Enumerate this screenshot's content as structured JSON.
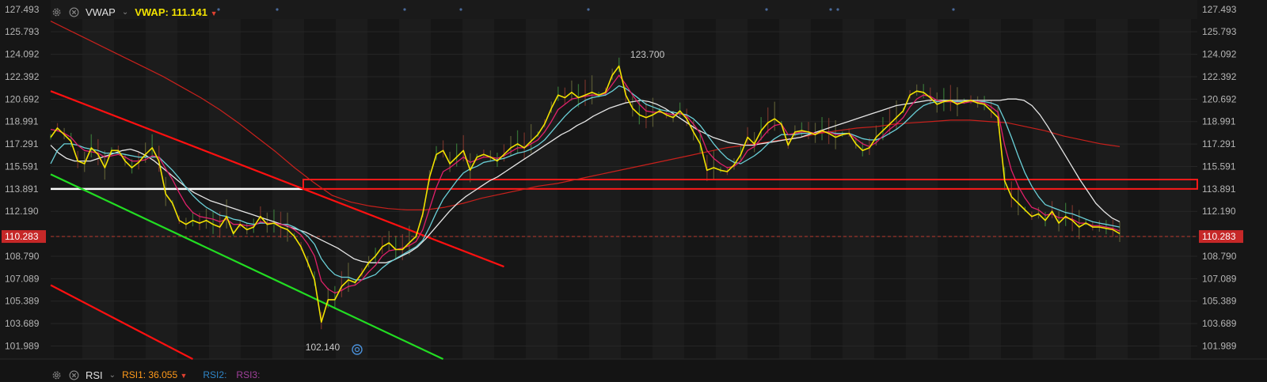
{
  "colors": {
    "background": "#161616",
    "grid": "#262626",
    "price_line": "#f2e200",
    "fast_ma": "#e0206a",
    "mid_ma": "#6ad0d8",
    "slow_ma": "#e6e6e6",
    "long_ma": "#c8211c",
    "level_red": "#ff1a1a",
    "level_white": "#ffffff",
    "trend_red": "#ff1010",
    "trend_green": "#22dd22",
    "current_price": "#e04030",
    "axis_text": "#b5b5b5",
    "rsi1": "#ff9a1a",
    "rsi2": "#2f86c8",
    "rsi3": "#a0409a"
  },
  "vwap_header": {
    "name": "VWAP",
    "value_label": "VWAP:",
    "value": "111.141",
    "settings_icon": "gear-icon",
    "close_icon": "close-icon",
    "chevron_icon": "chevron-down-icon"
  },
  "rsi_header": {
    "name": "RSI",
    "rsi1_label": "RSI1:",
    "rsi1_value": "36.055",
    "rsi2_label": "RSI2:",
    "rsi3_label": "RSI3:",
    "settings_icon": "gear-icon",
    "close_icon": "close-icon",
    "chevron_icon": "chevron-down-icon"
  },
  "current_price": "110.283",
  "chart_data": {
    "type": "line",
    "ylim": [
      101.0,
      128.2
    ],
    "y_ticks": [
      "127.493",
      "125.793",
      "124.092",
      "122.392",
      "120.692",
      "118.991",
      "117.291",
      "115.591",
      "113.891",
      "112.190",
      "110.283",
      "108.790",
      "107.089",
      "105.389",
      "103.689",
      "101.989"
    ],
    "annotations": [
      {
        "text": "123.700",
        "bar": 88,
        "value": 123.7
      },
      {
        "text": "102.140",
        "bar": 40,
        "value": 102.14
      }
    ],
    "series": [
      {
        "values": [
          117.8,
          118.5,
          118.0,
          117.5,
          116.0,
          115.8,
          117.0,
          116.5,
          115.5,
          116.8,
          116.8,
          116.0,
          115.5,
          115.9,
          116.5,
          117.0,
          116.0,
          113.5,
          112.8,
          111.5,
          111.2,
          111.5,
          111.3,
          111.5,
          111.2,
          111.0,
          111.8,
          110.5,
          111.2,
          110.8,
          111.0,
          111.8,
          111.2,
          111.3,
          111.0,
          110.8,
          110.3,
          109.5,
          108.3,
          107.0,
          103.8,
          105.5,
          105.5,
          106.5,
          107.0,
          106.8,
          107.5,
          108.3,
          108.8,
          109.5,
          109.8,
          109.3,
          109.3,
          109.8,
          110.3,
          112.0,
          114.8,
          116.5,
          116.8,
          115.8,
          116.3,
          116.8,
          115.3,
          116.3,
          116.5,
          116.3,
          116.0,
          116.5,
          117.0,
          117.3,
          117.0,
          117.5,
          118.0,
          118.8,
          120.0,
          121.0,
          120.8,
          121.2,
          120.8,
          121.0,
          121.2,
          121.0,
          121.2,
          122.5,
          123.2,
          121.0,
          120.0,
          119.5,
          119.3,
          119.5,
          119.8,
          119.5,
          119.3,
          119.8,
          119.2,
          118.2,
          117.3,
          115.3,
          115.5,
          115.3,
          115.2,
          115.7,
          116.5,
          117.8,
          117.3,
          118.3,
          118.9,
          119.2,
          118.8,
          117.2,
          118.2,
          118.3,
          118.2,
          118.0,
          118.3,
          118.1,
          117.8,
          118.0,
          118.1,
          117.3,
          116.8,
          117.0,
          117.8,
          118.3,
          118.8,
          119.3,
          119.8,
          121.0,
          121.3,
          121.2,
          120.8,
          120.3,
          120.5,
          120.6,
          120.3,
          120.5,
          120.6,
          120.4,
          120.3,
          119.8,
          119.3,
          114.5,
          113.3,
          112.8,
          112.3,
          111.8,
          112.0,
          111.5,
          112.2,
          111.3,
          111.8,
          111.5,
          111.0,
          111.3,
          111.0,
          111.0,
          110.9,
          110.8,
          110.5
        ]
      },
      {
        "values": [
          118.4,
          118.3,
          118.1,
          117.8,
          117.2,
          116.8,
          116.7,
          116.6,
          116.3,
          116.4,
          116.5,
          116.3,
          116.0,
          116.0,
          116.1,
          116.4,
          116.3,
          115.4,
          114.6,
          113.6,
          112.7,
          112.1,
          111.8,
          111.7,
          111.6,
          111.4,
          111.6,
          111.2,
          111.2,
          111.1,
          111.1,
          111.4,
          111.3,
          111.3,
          111.2,
          111.1,
          110.8,
          110.4,
          109.7,
          108.8,
          106.9,
          106.3,
          106.0,
          106.2,
          106.5,
          106.6,
          107.0,
          107.6,
          108.1,
          108.8,
          109.2,
          109.3,
          109.4,
          109.6,
          109.9,
          110.8,
          112.4,
          114.0,
          115.2,
          115.5,
          115.9,
          116.3,
          115.9,
          116.1,
          116.3,
          116.3,
          116.2,
          116.4,
          116.7,
          117.0,
          117.0,
          117.3,
          117.6,
          118.2,
          119.0,
          119.9,
          120.3,
          120.7,
          120.8,
          120.9,
          121.0,
          121.0,
          121.1,
          121.8,
          122.5,
          121.8,
          121.0,
          120.3,
          119.8,
          119.7,
          119.7,
          119.6,
          119.5,
          119.6,
          119.4,
          118.8,
          118.1,
          116.8,
          116.2,
          115.8,
          115.5,
          115.6,
          116.0,
          116.8,
          117.1,
          117.7,
          118.3,
          118.7,
          118.8,
          118.0,
          118.1,
          118.2,
          118.2,
          118.1,
          118.2,
          118.2,
          118.0,
          118.0,
          118.1,
          117.7,
          117.3,
          117.1,
          117.4,
          117.9,
          118.4,
          118.8,
          119.3,
          120.1,
          120.7,
          121.0,
          120.9,
          120.6,
          120.5,
          120.5,
          120.4,
          120.4,
          120.5,
          120.5,
          120.4,
          120.1,
          119.7,
          117.2,
          115.3,
          114.1,
          113.2,
          112.5,
          112.3,
          111.9,
          112.0,
          111.7,
          111.7,
          111.6,
          111.3,
          111.3,
          111.1,
          111.1,
          111.0,
          110.9,
          110.7
        ]
      },
      {
        "values": [
          115.8,
          116.8,
          117.3,
          117.3,
          117.2,
          117.0,
          116.9,
          116.8,
          116.6,
          116.6,
          116.6,
          116.5,
          116.4,
          116.3,
          116.3,
          116.3,
          116.3,
          115.8,
          115.3,
          114.7,
          114.0,
          113.4,
          112.9,
          112.5,
          112.2,
          111.9,
          111.8,
          111.6,
          111.5,
          111.3,
          111.2,
          111.3,
          111.3,
          111.3,
          111.2,
          111.2,
          111.0,
          110.7,
          110.3,
          109.7,
          108.6,
          107.9,
          107.4,
          107.2,
          107.2,
          107.0,
          107.0,
          107.2,
          107.4,
          107.9,
          108.3,
          108.6,
          108.9,
          109.2,
          109.5,
          110.0,
          111.0,
          112.1,
          113.1,
          113.8,
          114.5,
          115.1,
          115.4,
          115.6,
          115.9,
          116.0,
          116.1,
          116.2,
          116.4,
          116.6,
          116.7,
          116.9,
          117.2,
          117.6,
          118.2,
          118.8,
          119.4,
          119.9,
          120.3,
          120.6,
          120.8,
          120.9,
          121.0,
          121.3,
          121.7,
          121.5,
          121.1,
          120.7,
          120.3,
          120.1,
          119.9,
          119.8,
          119.7,
          119.6,
          119.5,
          119.2,
          118.7,
          118.0,
          117.3,
          116.7,
          116.2,
          115.9,
          115.8,
          116.1,
          116.4,
          116.8,
          117.3,
          117.7,
          118.0,
          118.0,
          118.0,
          118.1,
          118.1,
          118.1,
          118.2,
          118.2,
          118.1,
          118.1,
          118.1,
          117.9,
          117.7,
          117.6,
          117.6,
          117.8,
          118.1,
          118.4,
          118.8,
          119.3,
          119.8,
          120.2,
          120.4,
          120.5,
          120.5,
          120.5,
          120.5,
          120.5,
          120.5,
          120.5,
          120.5,
          120.4,
          120.2,
          119.1,
          117.8,
          116.4,
          115.1,
          114.1,
          113.3,
          112.7,
          112.5,
          112.3,
          112.1,
          112.0,
          111.8,
          111.6,
          111.4,
          111.3,
          111.2,
          111.1,
          111.0
        ]
      },
      {
        "values": [
          117.2,
          116.6,
          116.2,
          116.0,
          116.0,
          116.0,
          116.2,
          116.4,
          116.6,
          116.8,
          116.9,
          116.7,
          116.4,
          116.0,
          115.5,
          115.0,
          114.5,
          114.0,
          113.6,
          113.3,
          113.0,
          112.8,
          112.6,
          112.4,
          112.2,
          112.0,
          111.8,
          111.6,
          111.4,
          111.2,
          111.0,
          110.8,
          110.6,
          110.3,
          110.0,
          109.7,
          109.4,
          109.0,
          108.6,
          108.4,
          108.3,
          108.3,
          108.3,
          108.5,
          108.8,
          109.1,
          109.5,
          110.1,
          110.8,
          111.5,
          112.2,
          112.8,
          113.3,
          113.7,
          114.1,
          114.5,
          114.8,
          115.2,
          115.6,
          116.0,
          116.4,
          116.8,
          117.2,
          117.6,
          118.0,
          118.3,
          118.7,
          119.0,
          119.4,
          119.7,
          120.0,
          120.2,
          120.4,
          120.5,
          120.6,
          120.5,
          120.3,
          120.0,
          119.6,
          119.2,
          118.8,
          118.4,
          118.1,
          117.8,
          117.6,
          117.4,
          117.3,
          117.2,
          117.2,
          117.3,
          117.4,
          117.5,
          117.6,
          117.7,
          117.8,
          118.0,
          118.2,
          118.4,
          118.6,
          118.8,
          119.0,
          119.2,
          119.4,
          119.6,
          119.8,
          120.0,
          120.2,
          120.3,
          120.4,
          120.5,
          120.6,
          120.6,
          120.6,
          120.6,
          120.6,
          120.6,
          120.6,
          120.6,
          120.6,
          120.6,
          120.7,
          120.7,
          120.6,
          120.2,
          119.5,
          118.6,
          117.6,
          116.6,
          115.6,
          114.6,
          113.7,
          112.8,
          112.2,
          111.7,
          111.4
        ]
      },
      {
        "values": [
          126.6,
          125.9,
          125.2,
          124.5,
          123.8,
          123.1,
          122.4,
          121.6,
          120.8,
          119.9,
          118.9,
          117.8,
          116.7,
          115.5,
          114.4,
          113.4,
          112.9,
          112.6,
          112.4,
          112.3,
          112.3,
          112.5,
          112.8,
          113.2,
          113.5,
          113.8,
          114.1,
          114.3,
          114.6,
          114.9,
          115.2,
          115.5,
          115.8,
          116.1,
          116.4,
          116.7,
          117.0,
          117.2,
          117.4,
          117.6,
          117.8,
          118.1,
          118.3,
          118.5,
          118.6,
          118.8,
          118.9,
          119.0,
          119.1,
          119.1,
          119.0,
          118.9,
          118.6,
          118.3,
          117.9,
          117.6,
          117.3,
          117.1
        ]
      }
    ],
    "levels": [
      114.6,
      113.891
    ],
    "trend_lines": [
      {
        "from": [
          0,
          121.3
        ],
        "to": [
          67,
          108.0
        ]
      },
      {
        "from": [
          0,
          115.0
        ],
        "to": [
          58,
          101.0
        ]
      },
      {
        "from": [
          0,
          106.6
        ],
        "to": [
          21,
          101.0
        ]
      }
    ]
  }
}
